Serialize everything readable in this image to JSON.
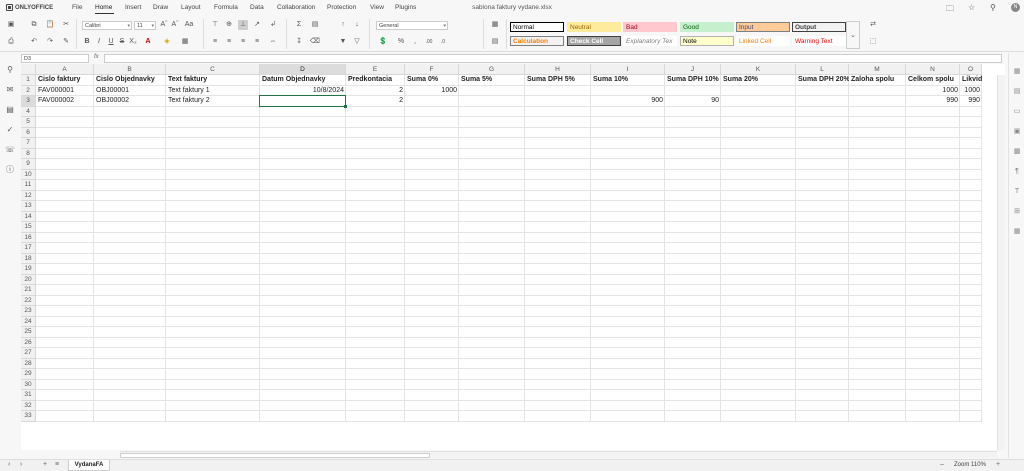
{
  "app": {
    "logo": "ONLYOFFICE",
    "document_title": "sablona faktury vydane.xlsx",
    "user_initial": "N"
  },
  "menu": [
    "File",
    "Home",
    "Insert",
    "Draw",
    "Layout",
    "Formula",
    "Data",
    "Collaboration",
    "Protection",
    "View",
    "Plugins"
  ],
  "active_menu": "Home",
  "toolbar": {
    "font_name": "Calibri",
    "font_size": "11",
    "number_format": "General",
    "cell_styles": [
      {
        "label": "Normal",
        "bg": "#ffffff",
        "color": "#000000",
        "border": "#000000"
      },
      {
        "label": "Neutral",
        "bg": "#ffeb9c",
        "color": "#9c6500",
        "border": "#ffeb9c"
      },
      {
        "label": "Bad",
        "bg": "#ffc7ce",
        "color": "#9c0006",
        "border": "#ffc7ce"
      },
      {
        "label": "Good",
        "bg": "#c6efce",
        "color": "#006100",
        "border": "#c6efce"
      },
      {
        "label": "Input",
        "bg": "#ffcc99",
        "color": "#3f3f76",
        "border": "#7f7f7f"
      },
      {
        "label": "Output",
        "bg": "#f2f2f2",
        "color": "#3f3f3f",
        "border": "#3f3f3f"
      },
      {
        "label": "Calculation",
        "bg": "#f2f2f2",
        "color": "#fa7d00",
        "border": "#7f7f7f"
      },
      {
        "label": "Check Cell",
        "bg": "#a5a5a5",
        "color": "#ffffff",
        "border": "#3f3f3f"
      },
      {
        "label": "Explanatory Tex",
        "bg": "#ffffff",
        "color": "#7f7f7f",
        "border": "#ffffff"
      },
      {
        "label": "Note",
        "bg": "#ffffcc",
        "color": "#000000",
        "border": "#b2b2b2"
      },
      {
        "label": "Linked Cell",
        "bg": "#ffffff",
        "color": "#fa7d00",
        "border": "#ffffff"
      },
      {
        "label": "Warning Text",
        "bg": "#ffffff",
        "color": "#ff0000",
        "border": "#ffffff"
      }
    ]
  },
  "formula_bar": {
    "name_box": "D3",
    "fx": "fx",
    "formula": ""
  },
  "sheet": {
    "columns": [
      "A",
      "B",
      "C",
      "D",
      "E",
      "F",
      "G",
      "H",
      "I",
      "J",
      "K",
      "L",
      "M",
      "N",
      "O"
    ],
    "selected_column": "D",
    "selected_row": 3,
    "row_count": 33,
    "header_row": [
      "Cislo faktury",
      "Cislo Objednavky",
      "Text faktury",
      "Datum Objednavky",
      "Predkontacia",
      "Suma 0%",
      "Suma 5%",
      "Suma DPH 5%",
      "Suma 10%",
      "Suma DPH 10%",
      "Suma 20%",
      "Suma DPH 20%",
      "Zaloha spolu",
      "Celkom spolu",
      "Likvidaci"
    ],
    "rows": [
      [
        "FAV000001",
        "OBJ00001",
        "Text faktury 1",
        "10/8/2024",
        "2",
        "1000",
        "",
        "",
        "",
        "",
        "",
        "",
        "",
        "1000",
        "1000"
      ],
      [
        "FAV000002",
        "OBJ00002",
        "Text faktury 2",
        "",
        "2",
        "",
        "",
        "",
        "900",
        "90",
        "",
        "",
        "",
        "990",
        "990"
      ]
    ],
    "right_aligned_columns": [
      3,
      4,
      5,
      8,
      9,
      13,
      14
    ]
  },
  "tabs": {
    "sheets": [
      "VydanaFA"
    ],
    "active": "VydanaFA"
  },
  "zoom": "Zoom 110%"
}
